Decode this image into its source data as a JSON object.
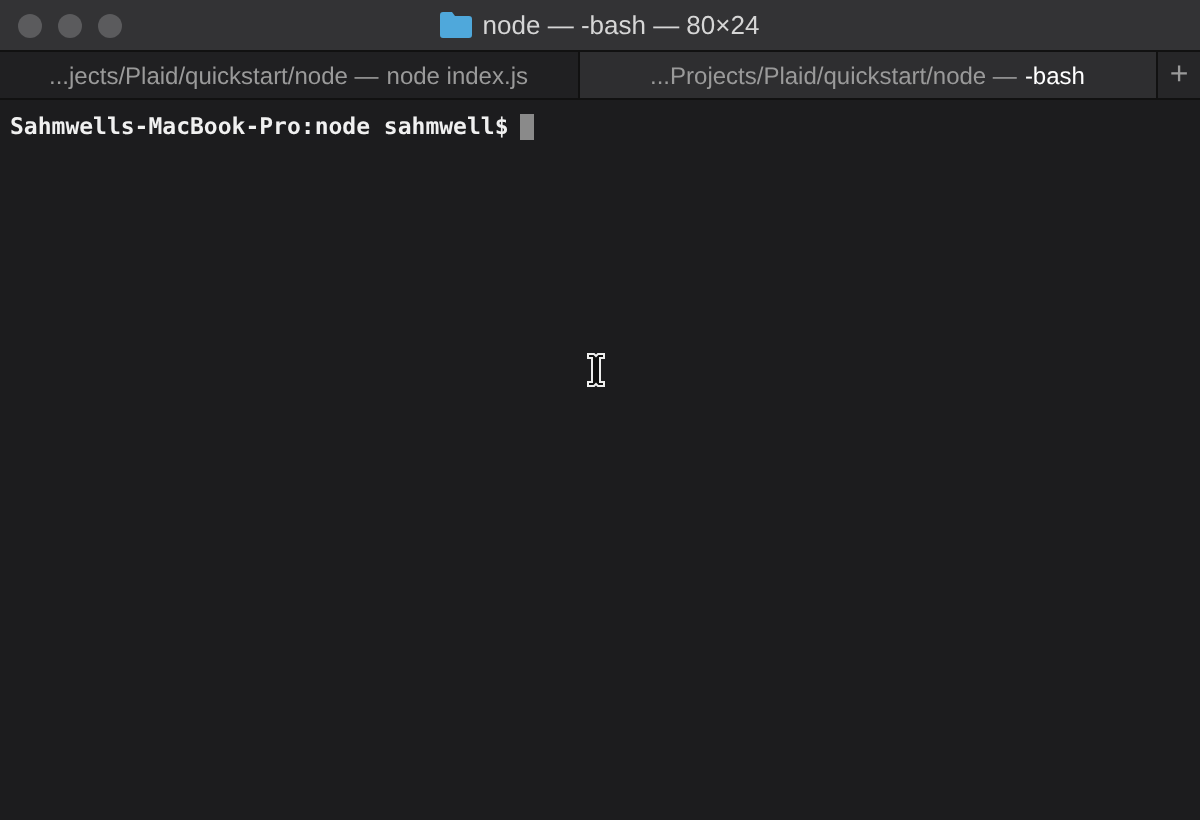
{
  "window": {
    "title": "node — -bash — 80×24"
  },
  "tabs": [
    {
      "path": "...jects/Plaid/quickstart/node —",
      "command": "node index.js",
      "selected": false
    },
    {
      "path": "...Projects/Plaid/quickstart/node —",
      "command": "-bash",
      "selected": true
    }
  ],
  "new_tab": {
    "label": "+"
  },
  "terminal": {
    "prompt": "Sahmwells-MacBook-Pro:node sahmwell$"
  }
}
